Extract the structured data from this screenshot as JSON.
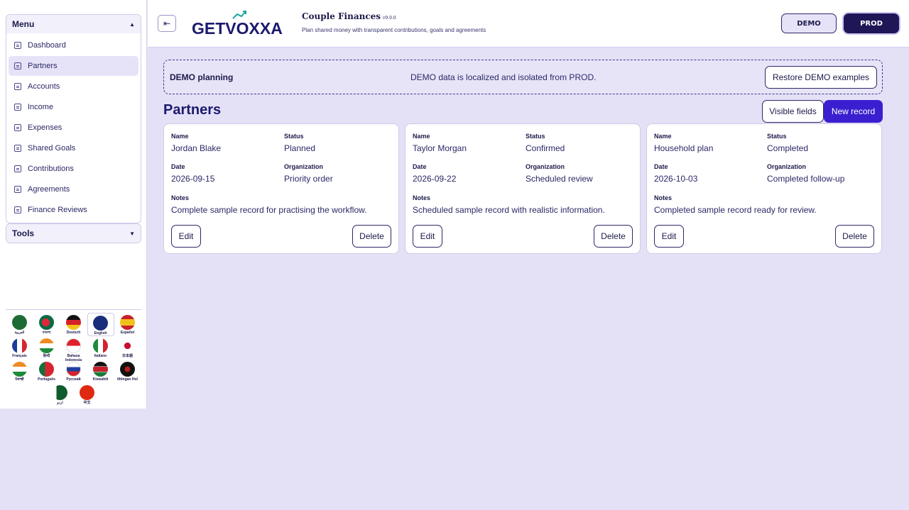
{
  "sidebar": {
    "menu_title": "Menu",
    "tools_title": "Tools",
    "items": [
      {
        "label": "Dashboard"
      },
      {
        "label": "Partners"
      },
      {
        "label": "Accounts"
      },
      {
        "label": "Income"
      },
      {
        "label": "Expenses"
      },
      {
        "label": "Shared Goals"
      },
      {
        "label": "Contributions"
      },
      {
        "label": "Agreements"
      },
      {
        "label": "Finance Reviews"
      }
    ],
    "active_item": "Partners"
  },
  "languages": [
    {
      "label": "العربية",
      "flag": "saudi-arabia"
    },
    {
      "label": "বাংলা",
      "flag": "bangladesh"
    },
    {
      "label": "Deutsch",
      "flag": "germany"
    },
    {
      "label": "English",
      "flag": "united-kingdom"
    },
    {
      "label": "Español",
      "flag": "spain"
    },
    {
      "label": "Français",
      "flag": "france"
    },
    {
      "label": "हिन्दी",
      "flag": "india"
    },
    {
      "label": "Bahasa Indonesia",
      "flag": "indonesia"
    },
    {
      "label": "Italiano",
      "flag": "italy"
    },
    {
      "label": "日本語",
      "flag": "japan"
    },
    {
      "label": "ਪੰਜਾਬੀ",
      "flag": "india"
    },
    {
      "label": "Português",
      "flag": "portugal"
    },
    {
      "label": "Русский",
      "flag": "russia"
    },
    {
      "label": "Kiswahili",
      "flag": "kenya"
    },
    {
      "label": "tlhIngan Hol",
      "flag": "klingon"
    },
    {
      "label": "اردو",
      "flag": "pakistan"
    },
    {
      "label": "中文",
      "flag": "china"
    }
  ],
  "header": {
    "logo_text": "GETVOXXA",
    "app_title": "Couple Finances",
    "version": "v9.0.0",
    "subtitle": "Plan shared money with transparent contributions, goals and agreements",
    "demo_label": "DEMO",
    "prod_label": "PROD"
  },
  "banner": {
    "title": "DEMO planning",
    "note": "DEMO data is localized and isolated from PROD.",
    "restore_label": "Restore DEMO examples"
  },
  "page": {
    "title": "Partners",
    "visible_fields_label": "Visible fields",
    "new_record_label": "New record"
  },
  "field_labels": {
    "name": "Name",
    "status": "Status",
    "date": "Date",
    "organization": "Organization",
    "notes": "Notes"
  },
  "records": [
    {
      "name": "Jordan Blake",
      "status": "Planned",
      "date": "2026-09-15",
      "organization": "Priority order",
      "notes": "Complete sample record for practising the workflow.",
      "edit": "Edit",
      "delete": "Delete"
    },
    {
      "name": "Taylor Morgan",
      "status": "Confirmed",
      "date": "2026-09-22",
      "organization": "Scheduled review",
      "notes": "Scheduled sample record with realistic information.",
      "edit": "Edit",
      "delete": "Delete"
    },
    {
      "name": "Household plan",
      "status": "Completed",
      "date": "2026-10-03",
      "organization": "Completed follow-up",
      "notes": "Completed sample record ready for review.",
      "edit": "Edit",
      "delete": "Delete"
    }
  ],
  "colors": {
    "accent": "#3a1fd0",
    "prod_bg": "#1e1656",
    "background": "#e4e1f7"
  }
}
